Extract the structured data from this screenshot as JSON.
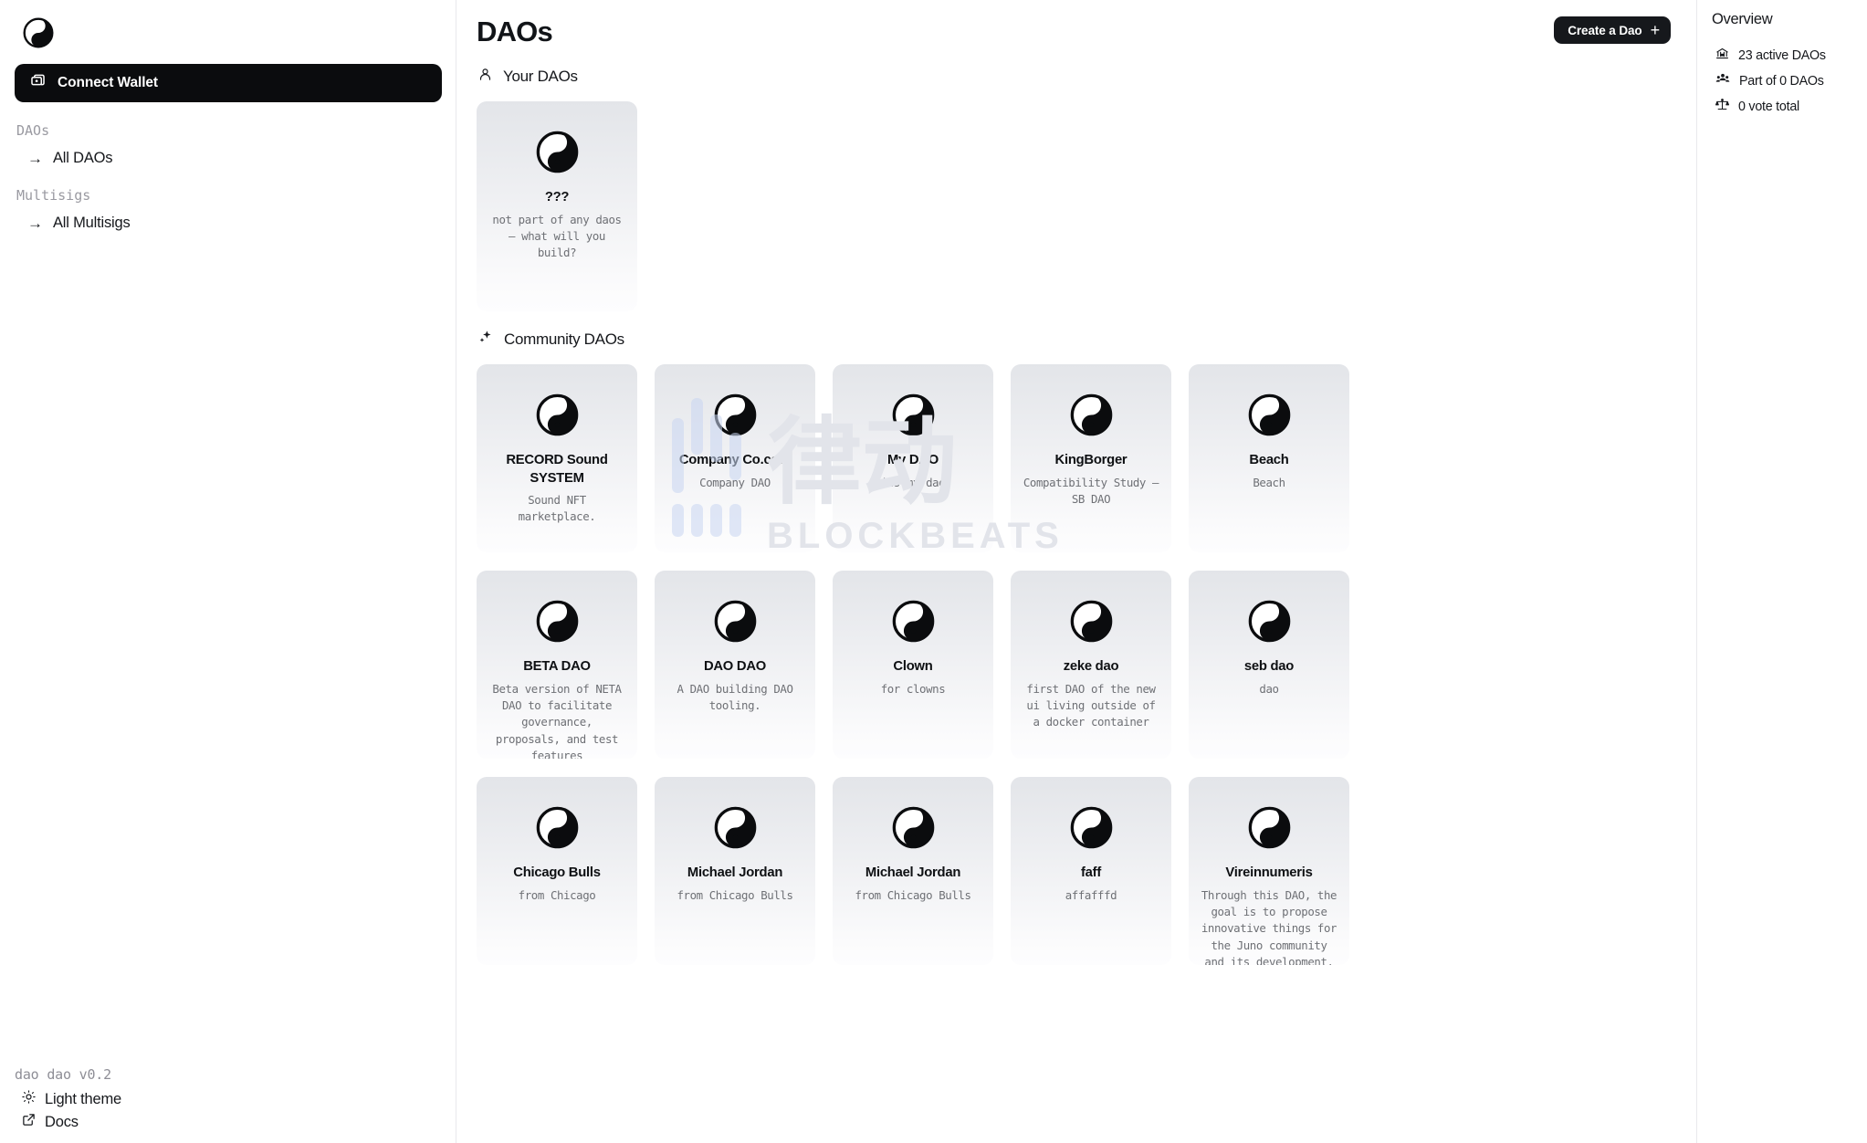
{
  "sidebar": {
    "logo_icon": "yinyang-logo-icon",
    "connect_wallet": {
      "label": "Connect Wallet",
      "icon": "wallet-icon"
    },
    "groups": [
      {
        "heading": "DAOs",
        "items": [
          {
            "label": "All DAOs",
            "icon": "arrow-right-icon"
          }
        ]
      },
      {
        "heading": "Multisigs",
        "items": [
          {
            "label": "All Multisigs",
            "icon": "arrow-right-icon"
          }
        ]
      }
    ],
    "version": "dao dao v0.2",
    "theme_toggle": {
      "label": "Light theme",
      "icon": "sun-icon"
    },
    "docs_link": {
      "label": "Docs",
      "icon": "external-link-icon"
    }
  },
  "header": {
    "title": "DAOs",
    "create_button": {
      "label": "Create a Dao",
      "icon": "plus-icon"
    }
  },
  "your_daos": {
    "heading": "Your DAOs",
    "heading_icon": "person-icon",
    "cards": [
      {
        "name": "???",
        "desc": "not part of any daos — what will you build?",
        "icon": "yinyang-icon"
      }
    ]
  },
  "community_daos": {
    "heading": "Community DAOs",
    "heading_icon": "sparkles-icon",
    "cards": [
      {
        "name": "RECORD Sound SYSTEM",
        "desc": "Sound NFT marketplace.",
        "icon": "yinyang-icon"
      },
      {
        "name": "Company Co.com",
        "desc": "Company DAO",
        "icon": "yinyang-icon"
      },
      {
        "name": "My DAO",
        "desc": "its my dao",
        "icon": "yinyang-icon"
      },
      {
        "name": "KingBorger",
        "desc": "Compatibility Study — SB DAO",
        "icon": "yinyang-icon"
      },
      {
        "name": "Beach",
        "desc": "Beach",
        "icon": "yinyang-icon"
      },
      {
        "name": "BETA DAO",
        "desc": "Beta version of NETA DAO to facilitate governance, proposals, and test features",
        "icon": "yinyang-icon"
      },
      {
        "name": "DAO DAO",
        "desc": "A DAO building DAO tooling.",
        "icon": "yinyang-icon"
      },
      {
        "name": "Clown",
        "desc": "for clowns",
        "icon": "yinyang-icon"
      },
      {
        "name": "zeke dao",
        "desc": "first DAO of the new ui living outside of a docker container",
        "icon": "yinyang-icon"
      },
      {
        "name": "seb dao",
        "desc": "dao",
        "icon": "yinyang-icon"
      },
      {
        "name": "Chicago Bulls",
        "desc": "from Chicago",
        "icon": "yinyang-icon"
      },
      {
        "name": "Michael Jordan",
        "desc": "from Chicago Bulls",
        "icon": "yinyang-icon"
      },
      {
        "name": "Michael Jordan",
        "desc": "from Chicago Bulls",
        "icon": "yinyang-icon"
      },
      {
        "name": "faff",
        "desc": "affafffd",
        "icon": "yinyang-icon"
      },
      {
        "name": "Vireinnumeris",
        "desc": "Through this DAO, the goal is to propose innovative things for the Juno community and its development. The launch of JunoSwap will allow Juno to",
        "icon": "yinyang-icon"
      }
    ]
  },
  "overview": {
    "title": "Overview",
    "stats": [
      {
        "label": "23 active DAOs",
        "icon": "bank-icon"
      },
      {
        "label": "Part of 0 DAOs",
        "icon": "people-icon"
      },
      {
        "label": "0 vote total",
        "icon": "scales-icon"
      }
    ]
  },
  "watermark": {
    "text": "BLOCKBEATS",
    "cjk": "律动"
  },
  "colors": {
    "accent_dark": "#16181c",
    "card_top": "#e3e5e9",
    "card_bottom": "#fdfdfe",
    "muted_text": "#6e7075",
    "divider": "#e9e9ec"
  }
}
